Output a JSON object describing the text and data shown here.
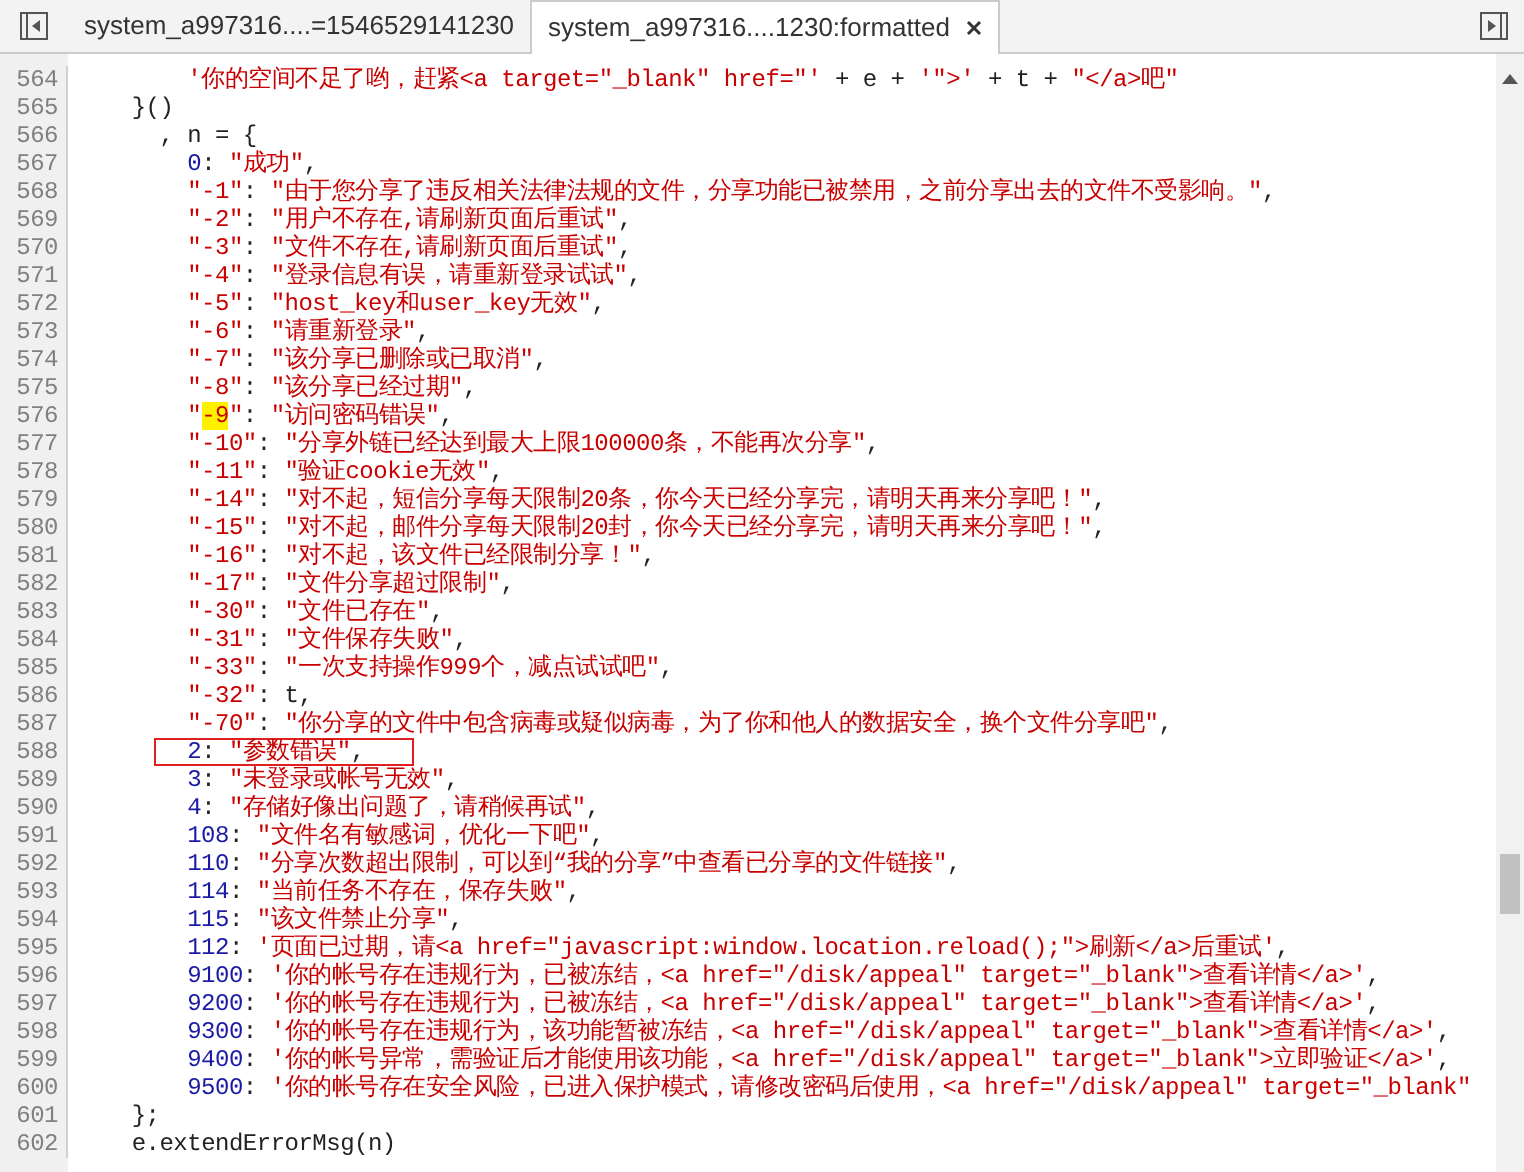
{
  "tabs": [
    {
      "label": "system_a997316....=1546529141230",
      "selected": false,
      "closable": false
    },
    {
      "label": "system_a997316....1230:formatted",
      "selected": true,
      "closable": true
    }
  ],
  "lines": [
    {
      "number": "564",
      "boxed": false,
      "segments": [
        {
          "kind": "string",
          "text": "        '你的空间不足了哟，赶紧<a target=\"_blank\" href=\"'"
        },
        {
          "kind": "plain",
          "text": " + e + "
        },
        {
          "kind": "string",
          "text": "'\">'"
        },
        {
          "kind": "plain",
          "text": " + t + "
        },
        {
          "kind": "string",
          "text": "\"</a>吧\""
        }
      ]
    },
    {
      "number": "565",
      "boxed": false,
      "segments": [
        {
          "kind": "plain",
          "text": "    }()"
        }
      ]
    },
    {
      "number": "566",
      "boxed": false,
      "segments": [
        {
          "kind": "plain",
          "text": "      , n = {"
        }
      ]
    },
    {
      "number": "567",
      "boxed": false,
      "segments": [
        {
          "kind": "number",
          "text": "        0"
        },
        {
          "kind": "plain",
          "text": ": "
        },
        {
          "kind": "string",
          "text": "\"成功\""
        },
        {
          "kind": "plain",
          "text": ","
        }
      ]
    },
    {
      "number": "568",
      "boxed": false,
      "segments": [
        {
          "kind": "string",
          "text": "        \"-1\""
        },
        {
          "kind": "plain",
          "text": ": "
        },
        {
          "kind": "string",
          "text": "\"由于您分享了违反相关法律法规的文件，分享功能已被禁用，之前分享出去的文件不受影响。\""
        },
        {
          "kind": "plain",
          "text": ","
        }
      ]
    },
    {
      "number": "569",
      "boxed": false,
      "segments": [
        {
          "kind": "string",
          "text": "        \"-2\""
        },
        {
          "kind": "plain",
          "text": ": "
        },
        {
          "kind": "string",
          "text": "\"用户不存在,请刷新页面后重试\""
        },
        {
          "kind": "plain",
          "text": ","
        }
      ]
    },
    {
      "number": "570",
      "boxed": false,
      "segments": [
        {
          "kind": "string",
          "text": "        \"-3\""
        },
        {
          "kind": "plain",
          "text": ": "
        },
        {
          "kind": "string",
          "text": "\"文件不存在,请刷新页面后重试\""
        },
        {
          "kind": "plain",
          "text": ","
        }
      ]
    },
    {
      "number": "571",
      "boxed": false,
      "segments": [
        {
          "kind": "string",
          "text": "        \"-4\""
        },
        {
          "kind": "plain",
          "text": ": "
        },
        {
          "kind": "string",
          "text": "\"登录信息有误，请重新登录试试\""
        },
        {
          "kind": "plain",
          "text": ","
        }
      ]
    },
    {
      "number": "572",
      "boxed": false,
      "segments": [
        {
          "kind": "string",
          "text": "        \"-5\""
        },
        {
          "kind": "plain",
          "text": ": "
        },
        {
          "kind": "string",
          "text": "\"host_key和user_key无效\""
        },
        {
          "kind": "plain",
          "text": ","
        }
      ]
    },
    {
      "number": "573",
      "boxed": false,
      "segments": [
        {
          "kind": "string",
          "text": "        \"-6\""
        },
        {
          "kind": "plain",
          "text": ": "
        },
        {
          "kind": "string",
          "text": "\"请重新登录\""
        },
        {
          "kind": "plain",
          "text": ","
        }
      ]
    },
    {
      "number": "574",
      "boxed": false,
      "segments": [
        {
          "kind": "string",
          "text": "        \"-7\""
        },
        {
          "kind": "plain",
          "text": ": "
        },
        {
          "kind": "string",
          "text": "\"该分享已删除或已取消\""
        },
        {
          "kind": "plain",
          "text": ","
        }
      ]
    },
    {
      "number": "575",
      "boxed": false,
      "segments": [
        {
          "kind": "string",
          "text": "        \"-8\""
        },
        {
          "kind": "plain",
          "text": ": "
        },
        {
          "kind": "string",
          "text": "\"该分享已经过期\""
        },
        {
          "kind": "plain",
          "text": ","
        }
      ]
    },
    {
      "number": "576",
      "boxed": false,
      "segments": [
        {
          "kind": "string",
          "text": "        \""
        },
        {
          "kind": "match",
          "text": "-9"
        },
        {
          "kind": "string",
          "text": "\""
        },
        {
          "kind": "plain",
          "text": ": "
        },
        {
          "kind": "string",
          "text": "\"访问密码错误\""
        },
        {
          "kind": "plain",
          "text": ","
        }
      ]
    },
    {
      "number": "577",
      "boxed": false,
      "segments": [
        {
          "kind": "string",
          "text": "        \"-10\""
        },
        {
          "kind": "plain",
          "text": ": "
        },
        {
          "kind": "string",
          "text": "\"分享外链已经达到最大上限100000条，不能再次分享\""
        },
        {
          "kind": "plain",
          "text": ","
        }
      ]
    },
    {
      "number": "578",
      "boxed": false,
      "segments": [
        {
          "kind": "string",
          "text": "        \"-11\""
        },
        {
          "kind": "plain",
          "text": ": "
        },
        {
          "kind": "string",
          "text": "\"验证cookie无效\""
        },
        {
          "kind": "plain",
          "text": ","
        }
      ]
    },
    {
      "number": "579",
      "boxed": false,
      "segments": [
        {
          "kind": "string",
          "text": "        \"-14\""
        },
        {
          "kind": "plain",
          "text": ": "
        },
        {
          "kind": "string",
          "text": "\"对不起，短信分享每天限制20条，你今天已经分享完，请明天再来分享吧！\""
        },
        {
          "kind": "plain",
          "text": ","
        }
      ]
    },
    {
      "number": "580",
      "boxed": false,
      "segments": [
        {
          "kind": "string",
          "text": "        \"-15\""
        },
        {
          "kind": "plain",
          "text": ": "
        },
        {
          "kind": "string",
          "text": "\"对不起，邮件分享每天限制20封，你今天已经分享完，请明天再来分享吧！\""
        },
        {
          "kind": "plain",
          "text": ","
        }
      ]
    },
    {
      "number": "581",
      "boxed": false,
      "segments": [
        {
          "kind": "string",
          "text": "        \"-16\""
        },
        {
          "kind": "plain",
          "text": ": "
        },
        {
          "kind": "string",
          "text": "\"对不起，该文件已经限制分享！\""
        },
        {
          "kind": "plain",
          "text": ","
        }
      ]
    },
    {
      "number": "582",
      "boxed": false,
      "segments": [
        {
          "kind": "string",
          "text": "        \"-17\""
        },
        {
          "kind": "plain",
          "text": ": "
        },
        {
          "kind": "string",
          "text": "\"文件分享超过限制\""
        },
        {
          "kind": "plain",
          "text": ","
        }
      ]
    },
    {
      "number": "583",
      "boxed": false,
      "segments": [
        {
          "kind": "string",
          "text": "        \"-30\""
        },
        {
          "kind": "plain",
          "text": ": "
        },
        {
          "kind": "string",
          "text": "\"文件已存在\""
        },
        {
          "kind": "plain",
          "text": ","
        }
      ]
    },
    {
      "number": "584",
      "boxed": false,
      "segments": [
        {
          "kind": "string",
          "text": "        \"-31\""
        },
        {
          "kind": "plain",
          "text": ": "
        },
        {
          "kind": "string",
          "text": "\"文件保存失败\""
        },
        {
          "kind": "plain",
          "text": ","
        }
      ]
    },
    {
      "number": "585",
      "boxed": false,
      "segments": [
        {
          "kind": "string",
          "text": "        \"-33\""
        },
        {
          "kind": "plain",
          "text": ": "
        },
        {
          "kind": "string",
          "text": "\"一次支持操作999个，减点试试吧\""
        },
        {
          "kind": "plain",
          "text": ","
        }
      ]
    },
    {
      "number": "586",
      "boxed": false,
      "segments": [
        {
          "kind": "string",
          "text": "        \"-32\""
        },
        {
          "kind": "plain",
          "text": ": t,"
        }
      ]
    },
    {
      "number": "587",
      "boxed": false,
      "segments": [
        {
          "kind": "string",
          "text": "        \"-70\""
        },
        {
          "kind": "plain",
          "text": ": "
        },
        {
          "kind": "string",
          "text": "\"你分享的文件中包含病毒或疑似病毒，为了你和他人的数据安全，换个文件分享吧\""
        },
        {
          "kind": "plain",
          "text": ","
        }
      ]
    },
    {
      "number": "588",
      "boxed": true,
      "segments": [
        {
          "kind": "number",
          "text": "        2"
        },
        {
          "kind": "plain",
          "text": ": "
        },
        {
          "kind": "string",
          "text": "\"参数错误\""
        },
        {
          "kind": "plain",
          "text": ","
        }
      ]
    },
    {
      "number": "589",
      "boxed": false,
      "segments": [
        {
          "kind": "number",
          "text": "        3"
        },
        {
          "kind": "plain",
          "text": ": "
        },
        {
          "kind": "string",
          "text": "\"未登录或帐号无效\""
        },
        {
          "kind": "plain",
          "text": ","
        }
      ]
    },
    {
      "number": "590",
      "boxed": false,
      "segments": [
        {
          "kind": "number",
          "text": "        4"
        },
        {
          "kind": "plain",
          "text": ": "
        },
        {
          "kind": "string",
          "text": "\"存储好像出问题了，请稍候再试\""
        },
        {
          "kind": "plain",
          "text": ","
        }
      ]
    },
    {
      "number": "591",
      "boxed": false,
      "segments": [
        {
          "kind": "number",
          "text": "        108"
        },
        {
          "kind": "plain",
          "text": ": "
        },
        {
          "kind": "string",
          "text": "\"文件名有敏感词，优化一下吧\""
        },
        {
          "kind": "plain",
          "text": ","
        }
      ]
    },
    {
      "number": "592",
      "boxed": false,
      "segments": [
        {
          "kind": "number",
          "text": "        110"
        },
        {
          "kind": "plain",
          "text": ": "
        },
        {
          "kind": "string",
          "text": "\"分享次数超出限制，可以到“我的分享”中查看已分享的文件链接\""
        },
        {
          "kind": "plain",
          "text": ","
        }
      ]
    },
    {
      "number": "593",
      "boxed": false,
      "segments": [
        {
          "kind": "number",
          "text": "        114"
        },
        {
          "kind": "plain",
          "text": ": "
        },
        {
          "kind": "string",
          "text": "\"当前任务不存在，保存失败\""
        },
        {
          "kind": "plain",
          "text": ","
        }
      ]
    },
    {
      "number": "594",
      "boxed": false,
      "segments": [
        {
          "kind": "number",
          "text": "        115"
        },
        {
          "kind": "plain",
          "text": ": "
        },
        {
          "kind": "string",
          "text": "\"该文件禁止分享\""
        },
        {
          "kind": "plain",
          "text": ","
        }
      ]
    },
    {
      "number": "595",
      "boxed": false,
      "segments": [
        {
          "kind": "number",
          "text": "        112"
        },
        {
          "kind": "plain",
          "text": ": "
        },
        {
          "kind": "string",
          "text": "'页面已过期，请<a href=\"javascript:window.location.reload();\">刷新</a>后重试'"
        },
        {
          "kind": "plain",
          "text": ","
        }
      ]
    },
    {
      "number": "596",
      "boxed": false,
      "segments": [
        {
          "kind": "number",
          "text": "        9100"
        },
        {
          "kind": "plain",
          "text": ": "
        },
        {
          "kind": "string",
          "text": "'你的帐号存在违规行为，已被冻结，<a href=\"/disk/appeal\" target=\"_blank\">查看详情</a>'"
        },
        {
          "kind": "plain",
          "text": ","
        }
      ]
    },
    {
      "number": "597",
      "boxed": false,
      "segments": [
        {
          "kind": "number",
          "text": "        9200"
        },
        {
          "kind": "plain",
          "text": ": "
        },
        {
          "kind": "string",
          "text": "'你的帐号存在违规行为，已被冻结，<a href=\"/disk/appeal\" target=\"_blank\">查看详情</a>'"
        },
        {
          "kind": "plain",
          "text": ","
        }
      ]
    },
    {
      "number": "598",
      "boxed": false,
      "segments": [
        {
          "kind": "number",
          "text": "        9300"
        },
        {
          "kind": "plain",
          "text": ": "
        },
        {
          "kind": "string",
          "text": "'你的帐号存在违规行为，该功能暂被冻结，<a href=\"/disk/appeal\" target=\"_blank\">查看详情</a>'"
        },
        {
          "kind": "plain",
          "text": ","
        }
      ]
    },
    {
      "number": "599",
      "boxed": false,
      "segments": [
        {
          "kind": "number",
          "text": "        9400"
        },
        {
          "kind": "plain",
          "text": ": "
        },
        {
          "kind": "string",
          "text": "'你的帐号异常，需验证后才能使用该功能，<a href=\"/disk/appeal\" target=\"_blank\">立即验证</a>'"
        },
        {
          "kind": "plain",
          "text": ","
        }
      ]
    },
    {
      "number": "600",
      "boxed": false,
      "segments": [
        {
          "kind": "number",
          "text": "        9500"
        },
        {
          "kind": "plain",
          "text": ": "
        },
        {
          "kind": "string",
          "text": "'你的帐号存在安全风险，已进入保护模式，请修改密码后使用，<a href=\"/disk/appeal\" target=\"_blank\""
        }
      ]
    },
    {
      "number": "601",
      "boxed": false,
      "segments": [
        {
          "kind": "plain",
          "text": "    };"
        }
      ]
    },
    {
      "number": "602",
      "boxed": false,
      "segments": [
        {
          "kind": "plain",
          "text": "    e.extendErrorMsg(n)"
        }
      ]
    }
  ]
}
